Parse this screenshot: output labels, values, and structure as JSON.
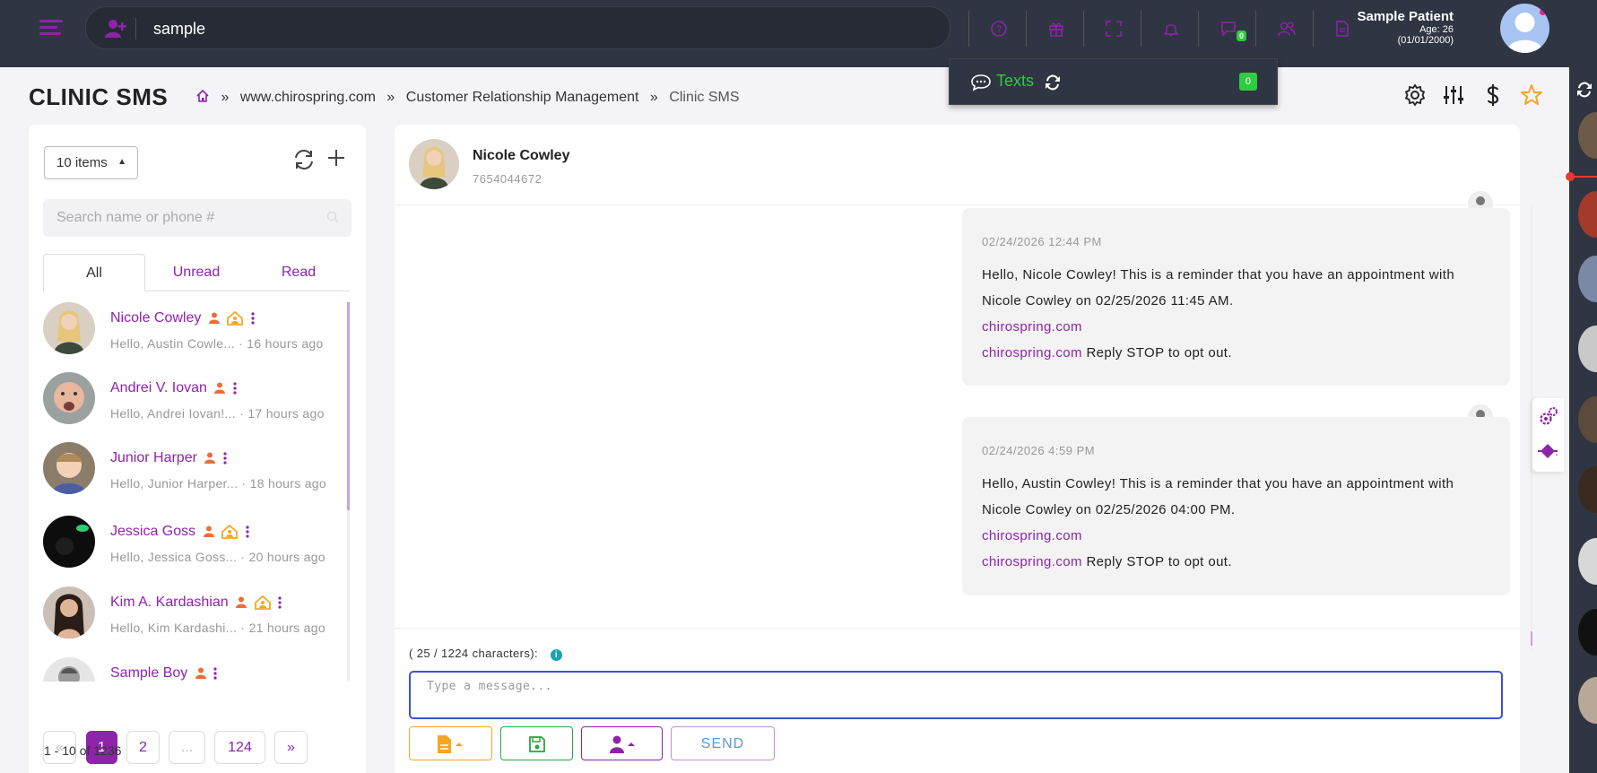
{
  "search": {
    "value": "sample"
  },
  "notifications": {
    "messages_count": "0"
  },
  "patient": {
    "name": "Sample Patient",
    "age": "Age: 26",
    "dob": "(01/01/2000)"
  },
  "texts_popup": {
    "label": "Texts",
    "count": "0"
  },
  "page": {
    "title": "CLINIC SMS",
    "breadcrumbs": [
      "www.chirospring.com",
      "Customer Relationship Management",
      "Clinic SMS"
    ],
    "separator": "»"
  },
  "left": {
    "items_select": "10 items",
    "search_placeholder": "Search name or phone #",
    "tabs": [
      "All",
      "Unread",
      "Read"
    ],
    "conversations": [
      {
        "name": "Nicole Cowley",
        "preview": "Hello, Austin Cowle...",
        "time": "· 16 hours ago"
      },
      {
        "name": "Andrei V. Iovan",
        "preview": "Hello, Andrei Iovan!...",
        "time": "· 17 hours ago"
      },
      {
        "name": "Junior Harper",
        "preview": "Hello, Junior Harper...",
        "time": "· 18 hours ago"
      },
      {
        "name": "Jessica Goss",
        "preview": "Hello, Jessica Goss...",
        "time": "· 20 hours ago"
      },
      {
        "name": "Kim A. Kardashian",
        "preview": "Hello, Kim Kardashi...",
        "time": "· 21 hours ago"
      },
      {
        "name": "Sample Boy",
        "preview": "",
        "time": ""
      }
    ],
    "pagination": {
      "prev": "«",
      "pages": [
        "1",
        "2",
        "...",
        "124"
      ],
      "next": "»",
      "summary": "1 - 10 of 1236"
    }
  },
  "chat": {
    "contact_name": "Nicole Cowley",
    "contact_phone": "7654044672",
    "messages": [
      {
        "timestamp": "02/24/2026 12:44 PM",
        "line1": "Hello, Nicole Cowley! This is a reminder that you have an appointment with Nicole Cowley on 02/25/2026 11:45 AM.",
        "link1": "chirospring.com",
        "link2": "chirospring.com",
        "tail": " Reply STOP to opt out."
      },
      {
        "timestamp": "02/24/2026 4:59 PM",
        "line1": "Hello, Austin Cowley! This is a reminder that you have an appointment with Nicole Cowley on 02/25/2026 04:00 PM.",
        "link1": "chirospring.com",
        "link2": "chirospring.com",
        "tail": " Reply STOP to opt out."
      }
    ],
    "char_count": "( 25 / 1224 characters):",
    "info_glyph": "i",
    "message_placeholder": "Type a message...",
    "send_label": "SEND"
  },
  "colors": {
    "accent": "#8e24aa",
    "topbar": "#2f3542",
    "success": "#2ecc40",
    "warning": "#f5a623"
  }
}
